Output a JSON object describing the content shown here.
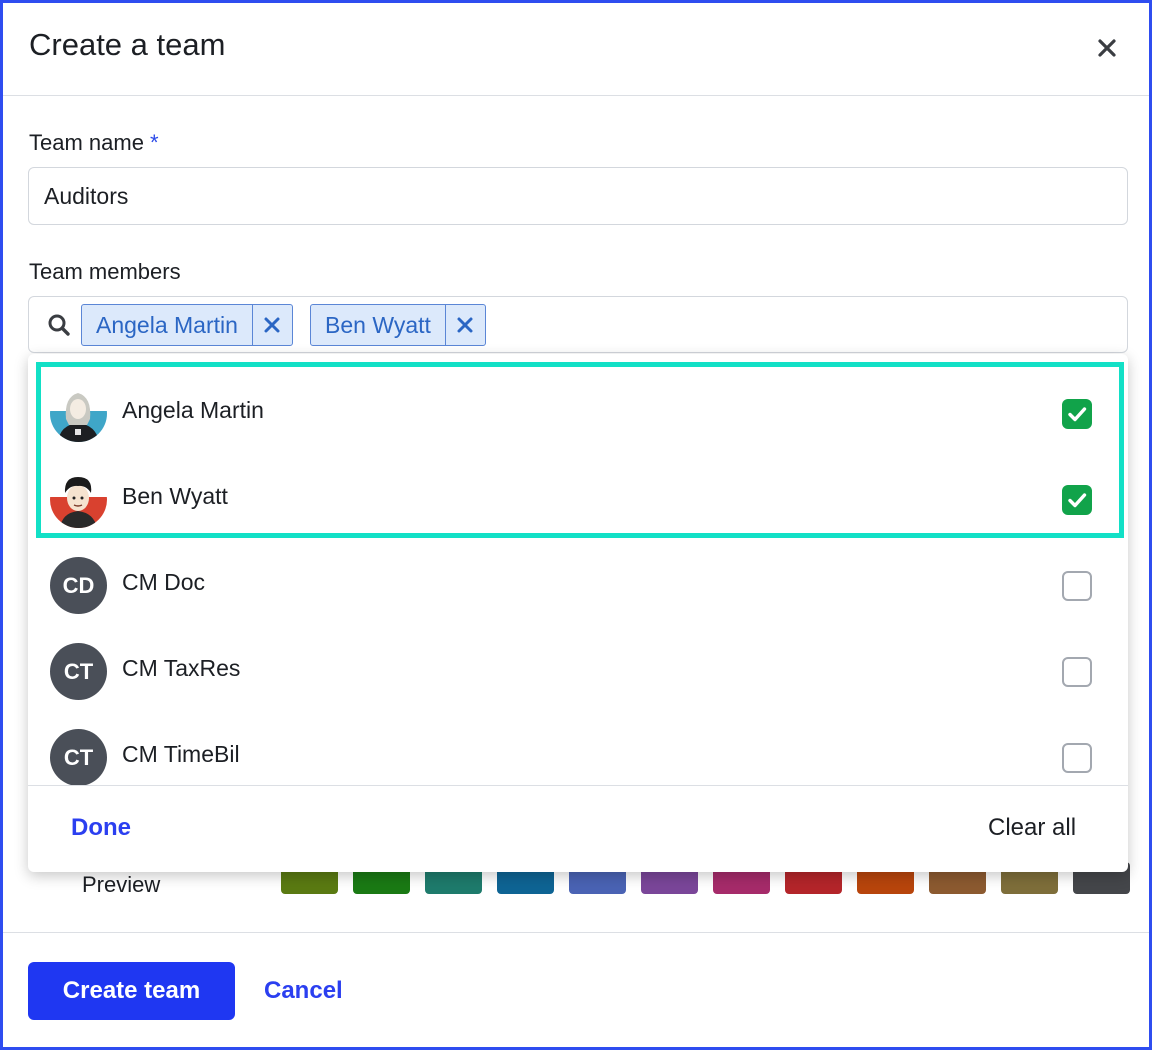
{
  "dialog": {
    "title": "Create a team"
  },
  "form": {
    "team_name_label": "Team name",
    "required_marker": "*",
    "team_name_value": "Auditors",
    "team_members_label": "Team members",
    "selected_chips": [
      {
        "label": "Angela Martin"
      },
      {
        "label": "Ben Wyatt"
      }
    ]
  },
  "dropdown": {
    "options": [
      {
        "name": "Angela Martin",
        "initials": "",
        "avatar": "photo-avatar",
        "checked": true
      },
      {
        "name": "Ben Wyatt",
        "initials": "",
        "avatar": "photo-avatar",
        "checked": true
      },
      {
        "name": "CM Doc",
        "initials": "CD",
        "avatar": "initials-avatar",
        "checked": false
      },
      {
        "name": "CM TaxRes",
        "initials": "CT",
        "avatar": "initials-avatar",
        "checked": false
      },
      {
        "name": "CM TimeBil",
        "initials": "CT",
        "avatar": "initials-avatar",
        "checked": false
      }
    ],
    "done_label": "Done",
    "clear_label": "Clear all"
  },
  "color_picker": {
    "preview_label": "Preview",
    "swatches": [
      "#5a7a12",
      "#1a7a14",
      "#1e7b6c",
      "#0e6494",
      "#4a63b4",
      "#7a4699",
      "#a62b6a",
      "#b4252a",
      "#b8450c",
      "#8c5a30",
      "#7e6e3a",
      "#44464a"
    ]
  },
  "actions": {
    "create_label": "Create team",
    "cancel_label": "Cancel"
  },
  "colors": {
    "accent": "#1f37f2",
    "check_green": "#11a34a",
    "highlight": "#12e0c6",
    "chip_bg": "#dce9fb"
  }
}
